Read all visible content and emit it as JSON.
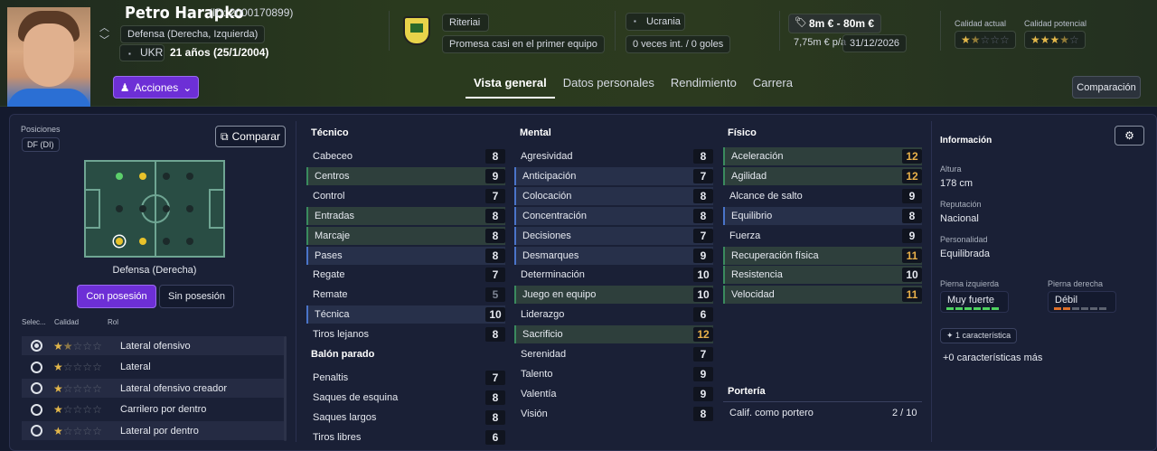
{
  "player": {
    "name": "Petro Harapko",
    "id": "(ID: 2000170899)",
    "position": "Defensa (Derecha, Izquierda)",
    "nation": "UKR",
    "age": "21 años (25/1/2004)",
    "actions": "Acciones"
  },
  "club": {
    "name": "Riteriai",
    "status": "Promesa casi en el primer equipo",
    "country": "Ucrania",
    "intl": "0 veces int. / 0 goles",
    "value": "8m € - 80m €",
    "contract": "7,75m € p/a",
    "contract_date": "31/12/2026",
    "current_quality_label": "Calidad actual",
    "potential_quality_label": "Calidad potencial",
    "current_stars": 1.5,
    "potential_stars": 3.5
  },
  "tabs": [
    "Vista general",
    "Datos personales",
    "Rendimiento",
    "Carrera"
  ],
  "compare_top": "Comparación",
  "left": {
    "positions_label": "Posiciones",
    "position_code": "DF (DI)",
    "compare": "Comparar",
    "role_name": "Defensa (Derecha)",
    "with_ball": "Con posesión",
    "without_ball": "Sin posesión",
    "col_sel": "Selec...",
    "col_quality": "Calidad",
    "col_role": "Rol",
    "roles": [
      {
        "name": "Lateral ofensivo",
        "stars": 1.5,
        "selected": true
      },
      {
        "name": "Lateral",
        "stars": 1,
        "selected": false
      },
      {
        "name": "Lateral ofensivo creador",
        "stars": 1,
        "selected": false
      },
      {
        "name": "Carrilero por dentro",
        "stars": 1,
        "selected": false
      },
      {
        "name": "Lateral por dentro",
        "stars": 1,
        "selected": false
      }
    ]
  },
  "tecnico": {
    "title": "Técnico",
    "attrs": [
      [
        "Cabeceo",
        "8"
      ],
      [
        "Centros",
        "9"
      ],
      [
        "Control",
        "7"
      ],
      [
        "Entradas",
        "8"
      ],
      [
        "Marcaje",
        "8"
      ],
      [
        "Pases",
        "8"
      ],
      [
        "Regate",
        "7"
      ],
      [
        "Remate",
        "5"
      ],
      [
        "Técnica",
        "10"
      ],
      [
        "Tiros lejanos",
        "8"
      ]
    ]
  },
  "balon": {
    "title": "Balón parado",
    "attrs": [
      [
        "Penaltis",
        "7"
      ],
      [
        "Saques de esquina",
        "8"
      ],
      [
        "Saques largos",
        "8"
      ],
      [
        "Tiros libres",
        "6"
      ]
    ]
  },
  "mental": {
    "title": "Mental",
    "attrs": [
      [
        "Agresividad",
        "8"
      ],
      [
        "Anticipación",
        "7"
      ],
      [
        "Colocación",
        "8"
      ],
      [
        "Concentración",
        "8"
      ],
      [
        "Decisiones",
        "7"
      ],
      [
        "Desmarques",
        "9"
      ],
      [
        "Determinación",
        "10"
      ],
      [
        "Juego en equipo",
        "10"
      ],
      [
        "Liderazgo",
        "6"
      ],
      [
        "Sacrificio",
        "12"
      ],
      [
        "Serenidad",
        "7"
      ],
      [
        "Talento",
        "9"
      ],
      [
        "Valentía",
        "9"
      ],
      [
        "Visión",
        "8"
      ]
    ]
  },
  "fisico": {
    "title": "Físico",
    "attrs": [
      [
        "Aceleración",
        "12"
      ],
      [
        "Agilidad",
        "12"
      ],
      [
        "Alcance de salto",
        "9"
      ],
      [
        "Equilibrio",
        "8"
      ],
      [
        "Fuerza",
        "9"
      ],
      [
        "Recuperación física",
        "11"
      ],
      [
        "Resistencia",
        "10"
      ],
      [
        "Velocidad",
        "11"
      ]
    ]
  },
  "porteria": {
    "title": "Portería",
    "label": "Calif. como portero",
    "value": "2 / 10"
  },
  "info": {
    "title": "Información",
    "height_label": "Altura",
    "height": "178 cm",
    "rep_label": "Reputación",
    "rep": "Nacional",
    "pers_label": "Personalidad",
    "pers": "Equilibrada",
    "left_foot_label": "Pierna izquierda",
    "left_foot": "Muy fuerte",
    "right_foot_label": "Pierna derecha",
    "right_foot": "Débil",
    "trait": "1 característica",
    "more": "+0 características más"
  }
}
